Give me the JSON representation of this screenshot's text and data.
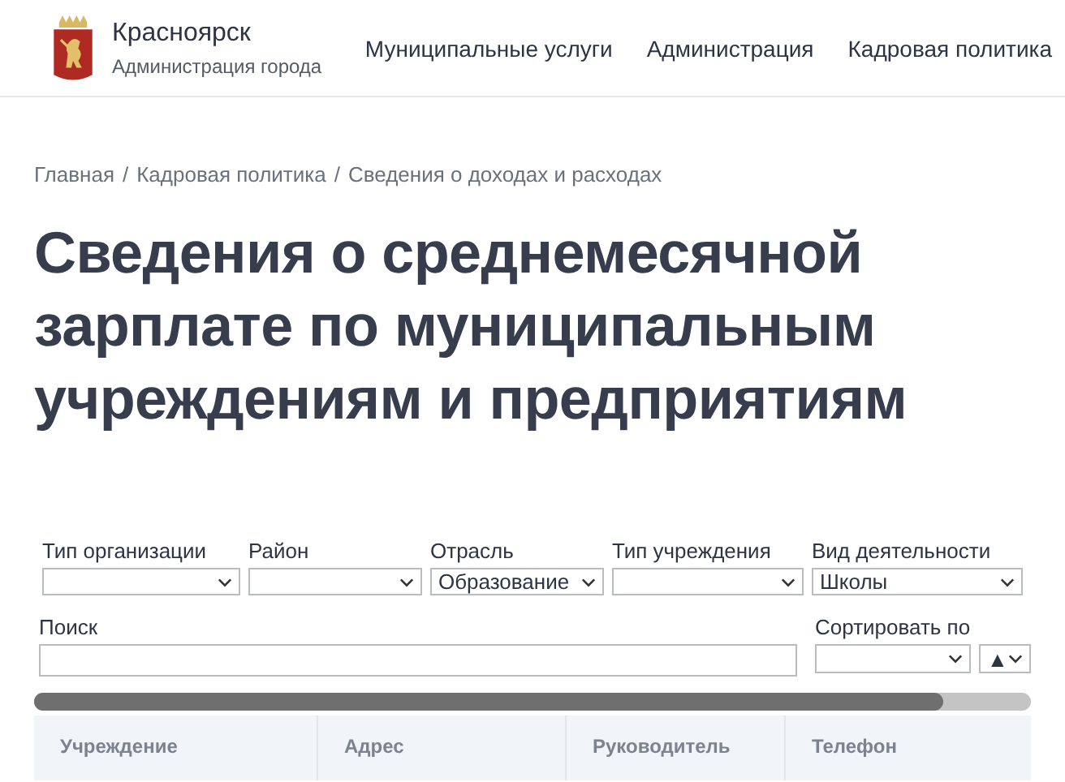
{
  "header": {
    "city": "Красноярск",
    "subtitle": "Администрация города",
    "nav": [
      {
        "label": "Муниципальные услуги"
      },
      {
        "label": "Администрация"
      },
      {
        "label": "Кадровая политика"
      }
    ]
  },
  "breadcrumbs": [
    "Главная",
    "/",
    "Кадровая политика",
    "/",
    "Сведения о доходах и расходах"
  ],
  "title": "Сведения о среднемесячной зарплате по муниципальным учреждениям и предприятиям",
  "filters": [
    {
      "label": "Тип организации"
    },
    {
      "label": "Район"
    },
    {
      "label": "Отрасль",
      "value": "Образование"
    },
    {
      "label": "Тип учреждения"
    },
    {
      "label": "Вид деятельности",
      "value": "Школы"
    }
  ],
  "search": {
    "label": "Поиск"
  },
  "sort": {
    "label": "Сортировать по",
    "order": "▲"
  },
  "table": {
    "columns": [
      "Учреждение",
      "Адрес",
      "Руководитель",
      "Телефон"
    ]
  }
}
